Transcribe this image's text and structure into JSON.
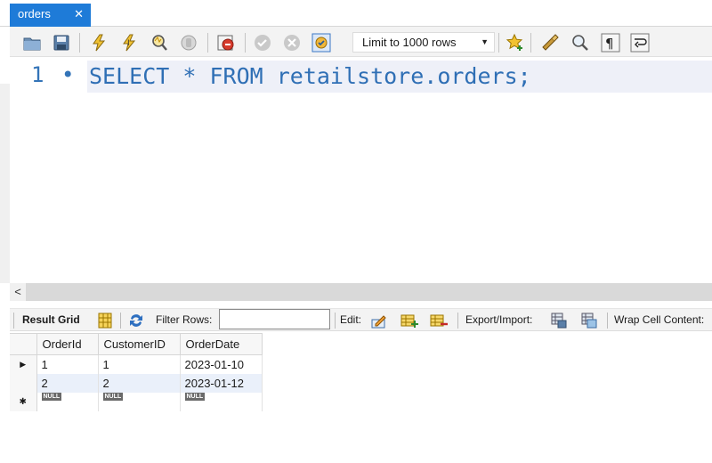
{
  "tab": {
    "title": "orders",
    "close_glyph": "✕"
  },
  "toolbar": {
    "limit_select": "Limit to 1000 rows",
    "icons": [
      "open-folder-icon",
      "save-icon",
      "execute-icon",
      "execute-current-icon",
      "explain-icon",
      "stop-icon",
      "toggle-error-icon",
      "commit-icon",
      "rollback-icon",
      "autocommit-icon",
      "favorite-icon",
      "beautify-icon",
      "find-icon",
      "invisible-chars-icon",
      "wrap-icon"
    ]
  },
  "editor": {
    "line_number": "1",
    "line_dot": "•",
    "code": "SELECT * FROM retailstore.orders;"
  },
  "scrollbar": {
    "left_arrow": "<"
  },
  "result_toolbar": {
    "result_grid": "Result Grid",
    "filter_rows": "Filter Rows:",
    "filter_value": "",
    "edit": "Edit:",
    "export_import": "Export/Import:",
    "wrap_cell": "Wrap Cell Content:"
  },
  "grid": {
    "columns": [
      "OrderId",
      "CustomerID",
      "OrderDate"
    ],
    "rows": [
      [
        "1",
        "1",
        "2023-01-10"
      ],
      [
        "2",
        "2",
        "2023-01-12"
      ]
    ],
    "null_label": "NULL",
    "current_row_marker": "▶",
    "new_row_marker": "✱"
  },
  "colors": {
    "tab_blue": "#1e7bd8",
    "keyword": "#2f6fb5",
    "line_highlight": "#eef0f8"
  }
}
